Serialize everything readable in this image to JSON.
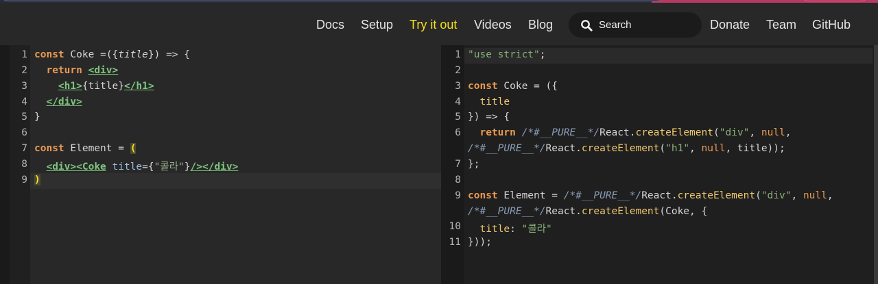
{
  "nav": {
    "items": [
      "Docs",
      "Setup",
      "Try it out",
      "Videos",
      "Blog"
    ],
    "active": "Try it out",
    "search_placeholder": "Search",
    "right_items": [
      "Donate",
      "Team",
      "GitHub"
    ]
  },
  "colors": {
    "active": "#f7df1e",
    "keyword": "#ea9a52",
    "jsx_tag": "#7ec57e"
  },
  "input_editor": {
    "line_numbers": [
      "1",
      "2",
      "3",
      "4",
      "5",
      "6",
      "7",
      "8",
      "9"
    ],
    "lines": [
      "const Coke =({title}) => {",
      "  return <div>",
      "    <h1>{title}</h1>",
      "  </div>",
      "}",
      "",
      "const Element = (",
      "  <div><Coke title={\"콜라\"}/></div>",
      ")"
    ]
  },
  "output_editor": {
    "line_numbers": [
      "1",
      "2",
      "3",
      "4",
      "5",
      "6",
      "",
      "7",
      "8",
      "9",
      "",
      "10",
      "11"
    ],
    "lines": [
      "\"use strict\";",
      "",
      "const Coke = ({",
      "  title",
      "}) => {",
      "  return /*#__PURE__*/React.createElement(\"div\", null,",
      "/*#__PURE__*/React.createElement(\"h1\", null, title));",
      "};",
      "",
      "const Element = /*#__PURE__*/React.createElement(\"div\", null,",
      "/*#__PURE__*/React.createElement(Coke, {",
      "  title: \"콜라\"",
      "}));"
    ]
  }
}
